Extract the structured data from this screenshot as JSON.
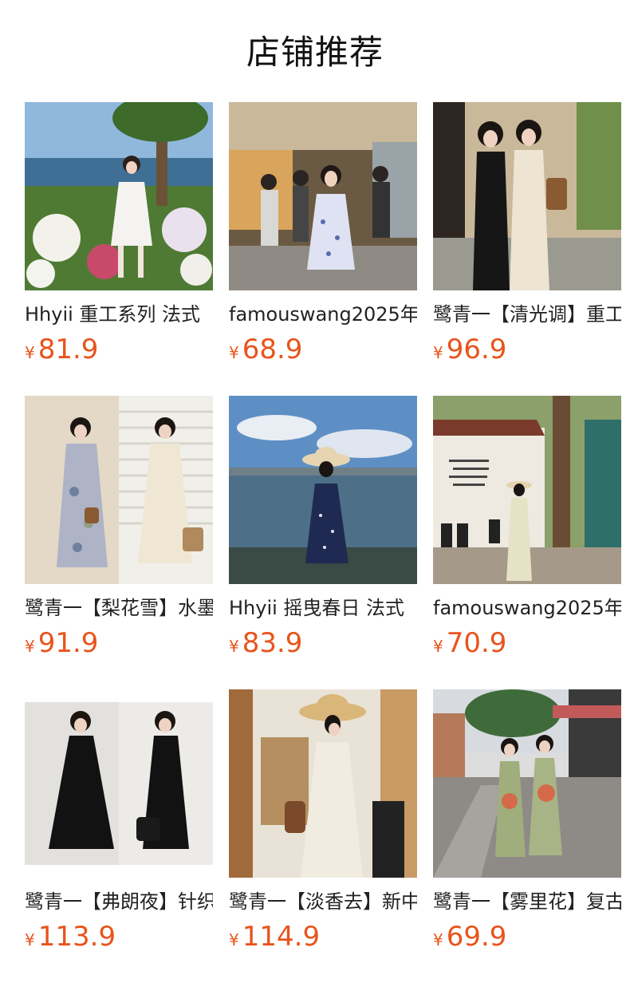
{
  "header": {
    "title": "店铺推荐"
  },
  "currency_symbol": "¥",
  "colors": {
    "price": "#e8541c",
    "title": "#111111",
    "name": "#222222"
  },
  "products": [
    {
      "name": "Hhyii 重工系列 法式",
      "price": "81.9",
      "image": "woman-white-dress-lakeside-flowers"
    },
    {
      "name": "famouswang2025年",
      "price": "68.9",
      "image": "woman-floral-dress-street-market"
    },
    {
      "name": "鹭青一【清光调】重工",
      "price": "96.9",
      "image": "two-women-qipao-dresses"
    },
    {
      "name": "鹭青一【梨花雪】水墨",
      "price": "91.9",
      "image": "woman-floral-maxi-dress-and-white-dress"
    },
    {
      "name": "Hhyii 摇曳春日 法式",
      "price": "83.9",
      "image": "woman-navy-dress-straw-hat-lake"
    },
    {
      "name": "famouswang2025年",
      "price": "70.9",
      "image": "woman-long-dress-cafe-street"
    },
    {
      "name": "鹭青一【弗朗夜】针织",
      "price": "113.9",
      "image": "woman-black-long-dress"
    },
    {
      "name": "鹭青一【淡香去】新中",
      "price": "114.9",
      "image": "woman-white-dress-straw-hat-indoor"
    },
    {
      "name": "鹭青一【雾里花】复古",
      "price": "69.9",
      "image": "two-women-print-slip-dresses-street"
    }
  ]
}
